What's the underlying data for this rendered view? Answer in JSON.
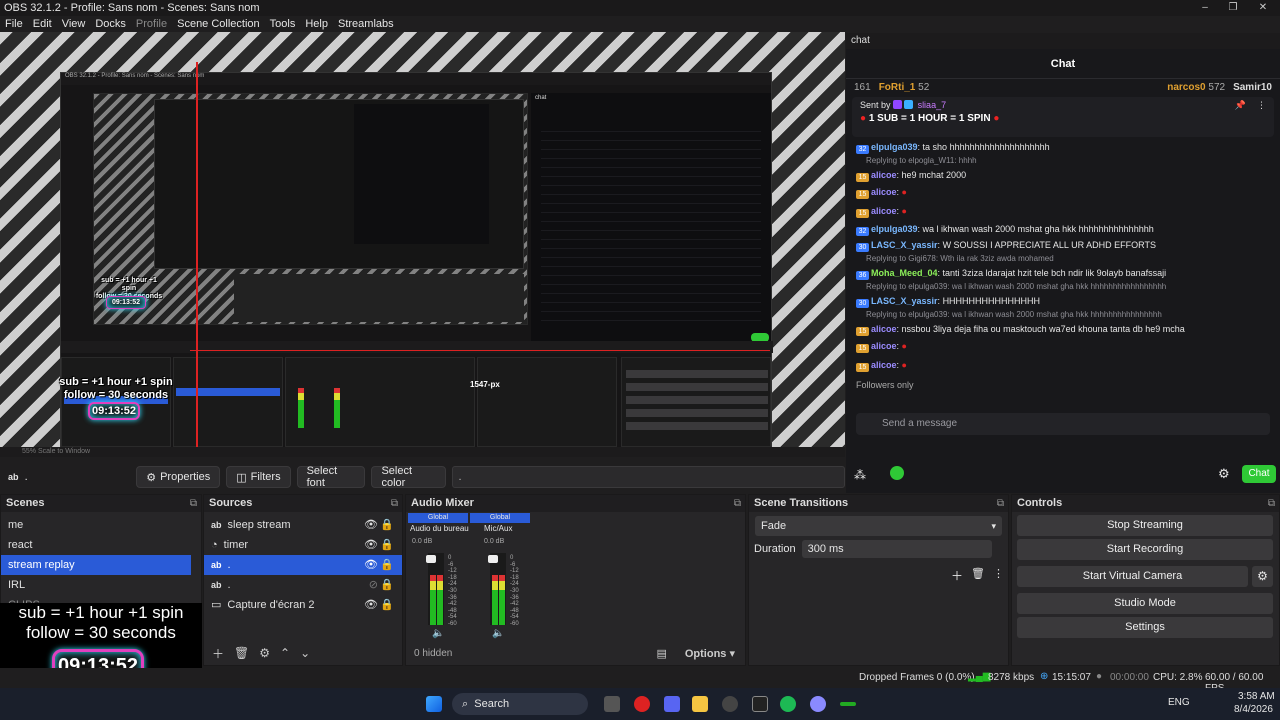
{
  "window": {
    "title": "OBS 32.1.2 - Profile: Sans nom - Scenes: Sans nom",
    "controls": [
      "–",
      "❐",
      "✕"
    ]
  },
  "menu": [
    "File",
    "Edit",
    "View",
    "Docks",
    "Profile",
    "Scene Collection",
    "Tools",
    "Help",
    "Streamlabs"
  ],
  "preview": {
    "overlay_line1": "sub  = +1 hour +1 spin",
    "overlay_line2": "follow = 30 seconds",
    "timer": "09:13:52",
    "nested_title": "OBS 32.1.2 - Profile: Sans nom - Scenes: Sans nom",
    "nested_chat_label": "chat",
    "nested_pixel_label": "1547-px",
    "nested_mini_overlay1": "sub  = +1 hour +1 spin",
    "nested_mini_overlay2": "follow = 30 seconds",
    "nested_mini_timer": "09:13:52",
    "zoom_label": "55%   Scale to Window"
  },
  "source_toolbar": {
    "source_name": ".",
    "properties": "Properties",
    "filters": "Filters",
    "select_font": "Select font",
    "select_color": "Select color",
    "text_value": "."
  },
  "chat": {
    "dock_title": "chat",
    "title": "Chat",
    "leaderboard": [
      {
        "rank_prefix": "161",
        "name": "FoRti_1",
        "score": "52"
      },
      {
        "name": "narcos0",
        "score": "572"
      },
      {
        "name": "Samir10",
        "score": ""
      }
    ],
    "pinned": {
      "sent_by_label": "Sent by",
      "sender": "sliaa_7",
      "message": "1 SUB = 1 HOUR = 1 SPIN"
    },
    "messages": [
      {
        "badge": "32",
        "user": "elpulga039",
        "text": "ta sho hhhhhhhhhhhhhhhhhhhh",
        "reply": ""
      },
      {
        "badge": "15",
        "user": "alicoe",
        "text": "he9 mchat 2000",
        "reply": "Replying to elpoglа_W11: hhhh"
      },
      {
        "badge": "15",
        "user": "alicoe",
        "text": "",
        "reply": ""
      },
      {
        "badge": "15",
        "user": "alicoe",
        "text": "",
        "reply": ""
      },
      {
        "badge": "32",
        "user": "elpulga039",
        "text": "wa l ikhwan wash 2000 mshat gha hkk hhhhhhhhhhhhhhh",
        "reply": ""
      },
      {
        "badge": "30",
        "user": "LASC_X_yassir",
        "text": "W SOUSSI I APPRECIATE ALL UR ADHD EFFORTS",
        "reply": ""
      },
      {
        "badge": "36",
        "user": "Moha_Meed_04",
        "text": "tanti 3ziza ldarajat hzit tele bch ndir lik 9olayb banafssaji",
        "reply": "Replying to Gigi678: Wth ila rak 3ziz awda mohamed"
      },
      {
        "badge": "30",
        "user": "LASC_X_yassir",
        "text": "HHHHHHHHHHHHHHH",
        "reply": "Replying to elpulga039: wa l ikhwan wash 2000 mshat gha hkk hhhhhhhhhhhhhhhhh"
      },
      {
        "badge": "15",
        "user": "alicoe",
        "text": "nssbou 3liya deja fiha ou masktouch wa7ed khouna tanta db he9 mcha",
        "reply": "Replying to elpulga039: wa l ikhwan wash 2000 mshat gha hkk hhhhhhhhhhhhhhhh"
      },
      {
        "badge": "15",
        "user": "alicoe",
        "text": "",
        "reply": ""
      },
      {
        "badge": "15",
        "user": "alicoe",
        "text": "",
        "reply": ""
      }
    ],
    "followers_only": "Followers only",
    "send_placeholder": "Send a message",
    "chat_button": "Chat"
  },
  "scenes": {
    "title": "Scenes",
    "items": [
      "me",
      "react",
      "stream replay",
      "IRL",
      "CLIPS"
    ],
    "selected": 2
  },
  "overlay_bottom": {
    "line1": "sub  = +1 hour +1 spin",
    "line2": "follow = 30 seconds",
    "timer": "09:13:52"
  },
  "sources": {
    "title": "Sources",
    "items": [
      "sleep stream",
      "timer",
      ".",
      ".",
      "Capture d'écran 2"
    ],
    "selected": 2
  },
  "audio": {
    "title": "Audio Mixer",
    "channels": [
      {
        "tag": "Global",
        "name": "Audio du bureau",
        "db": "0.0 dB",
        "level": 0.7
      },
      {
        "tag": "Global",
        "name": "Mic/Aux",
        "db": "0.0 dB",
        "level": 0.7
      }
    ],
    "scale": [
      "0",
      "-6",
      "-12",
      "-18",
      "-24",
      "-30",
      "-36",
      "-42",
      "-48",
      "-54",
      "-60"
    ],
    "hidden": "0 hidden",
    "options": "Options"
  },
  "transitions": {
    "title": "Scene Transitions",
    "selected": "Fade",
    "duration_label": "Duration",
    "duration": "300 ms"
  },
  "controls": {
    "title": "Controls",
    "buttons": [
      "Stop Streaming",
      "Start Recording",
      "Start Virtual Camera",
      "Studio Mode",
      "Settings"
    ]
  },
  "status": {
    "dropped": "Dropped Frames 0 (0.0%)",
    "bitrate": "8278 kbps",
    "live": "15:15:07",
    "rec": "00:00:00",
    "cpu": "CPU: 2.8%",
    "fps": "60.00 / 60.00 FPS"
  },
  "taskbar": {
    "search": "Search",
    "lang": "ENG",
    "time": "3:58 AM",
    "date": "8/4/2026"
  },
  "colors": {
    "accent": "#2a5bd7",
    "chat_green": "#2fc936",
    "timer_border": "#e040c0",
    "timer_glow": "#30e0ff"
  }
}
